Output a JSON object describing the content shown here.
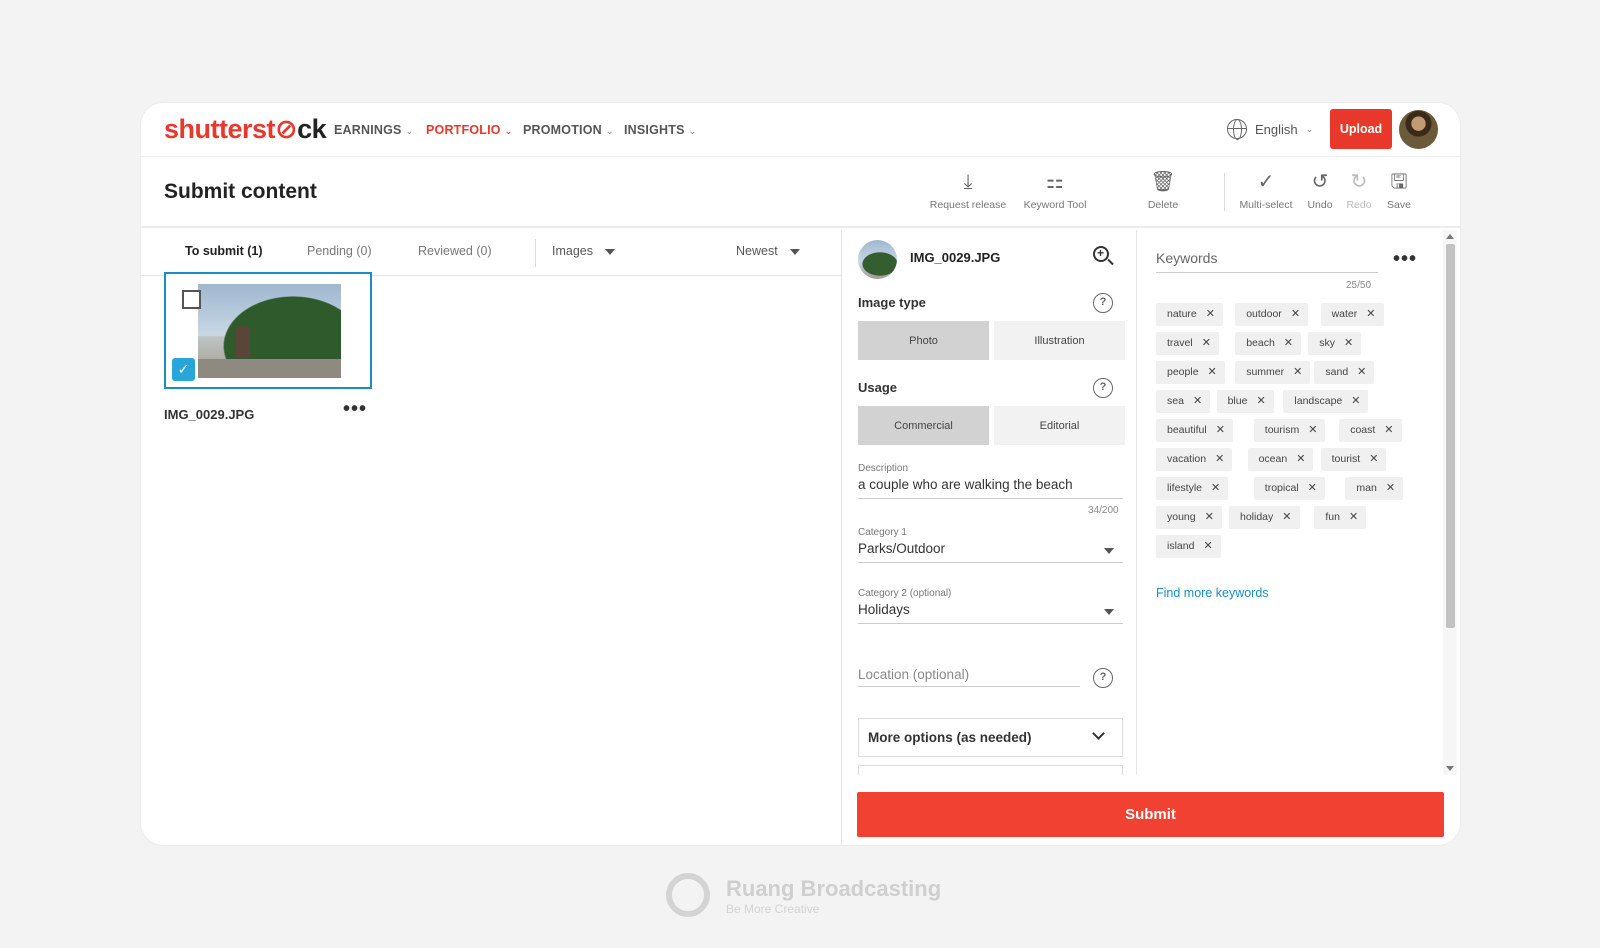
{
  "nav": {
    "logo_a": "shutterst",
    "logo_b": "ck",
    "items": [
      "EARNINGS",
      "PORTFOLIO",
      "PROMOTION",
      "INSIGHTS"
    ],
    "active": "PORTFOLIO",
    "language": "English",
    "upload": "Upload"
  },
  "header": {
    "title": "Submit content",
    "tools": {
      "request_release": "Request release",
      "keyword_tool": "Keyword Tool",
      "delete": "Delete",
      "multi_select": "Multi-select",
      "undo": "Undo",
      "redo": "Redo",
      "save": "Save"
    }
  },
  "tabs": {
    "to_submit": "To submit (1)",
    "pending": "Pending (0)",
    "reviewed": "Reviewed (0)",
    "filter": "Images",
    "sort": "Newest"
  },
  "asset": {
    "filename": "IMG_0029.JPG"
  },
  "form": {
    "image_type_label": "Image type",
    "image_type_options": [
      "Photo",
      "Illustration"
    ],
    "image_type_selected": "Photo",
    "usage_label": "Usage",
    "usage_options": [
      "Commercial",
      "Editorial"
    ],
    "usage_selected": "Commercial",
    "description_label": "Description",
    "description_value": "a couple who are walking the beach",
    "description_count": "34/200",
    "category1_label": "Category 1",
    "category1_value": "Parks/Outdoor",
    "category2_label": "Category 2 (optional)",
    "category2_value": "Holidays",
    "location_placeholder": "Location (optional)",
    "more_options": "More options (as needed)"
  },
  "keywords": {
    "title": "Keywords",
    "count": "25/50",
    "items": [
      "nature",
      "outdoor",
      "water",
      "travel",
      "beach",
      "sky",
      "people",
      "summer",
      "sand",
      "sea",
      "blue",
      "landscape",
      "beautiful",
      "tourism",
      "coast",
      "vacation",
      "ocean",
      "tourist",
      "lifestyle",
      "tropical",
      "man",
      "young",
      "holiday",
      "fun",
      "island"
    ],
    "find_more": "Find more keywords"
  },
  "submit_label": "Submit",
  "watermark": {
    "brand": "Ruang Broadcasting",
    "tagline": "Be More Creative"
  },
  "colors": {
    "brand_red": "#e8382c",
    "submit_red": "#f04133",
    "link_blue": "#1a8fbf",
    "selection_blue": "#1a8fbf"
  }
}
